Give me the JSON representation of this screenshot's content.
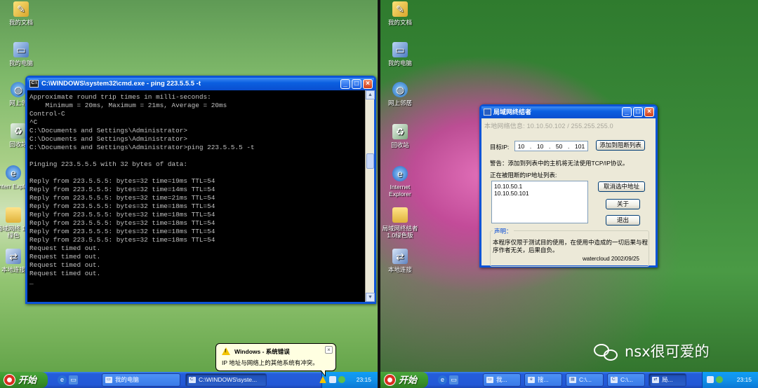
{
  "left_desktop": {
    "icons": [
      {
        "label": "我的文档",
        "icon": "my-documents-icon"
      },
      {
        "label": "我的电脑",
        "icon": "my-computer-icon"
      },
      {
        "label": "网上邻",
        "icon": "network-places-icon"
      },
      {
        "label": "回收站",
        "icon": "recycle-bin-icon"
      },
      {
        "label": "Interr Explor",
        "icon": "internet-explorer-icon"
      },
      {
        "label": "局域网终 1.0绿色",
        "icon": "folder-icon"
      },
      {
        "label": "本地连接",
        "icon": "network-connection-icon"
      }
    ]
  },
  "cmd": {
    "title": "C:\\WINDOWS\\system32\\cmd.exe - ping 223.5.5.5 -t",
    "output": "Approximate round trip times in milli-seconds:\n    Minimum = 20ms, Maximum = 21ms, Average = 20ms\nControl-C\n^C\nC:\\Documents and Settings\\Administrator>\nC:\\Documents and Settings\\Administrator>\nC:\\Documents and Settings\\Administrator>ping 223.5.5.5 -t\n\nPinging 223.5.5.5 with 32 bytes of data:\n\nReply from 223.5.5.5: bytes=32 time=19ms TTL=54\nReply from 223.5.5.5: bytes=32 time=14ms TTL=54\nReply from 223.5.5.5: bytes=32 time=21ms TTL=54\nReply from 223.5.5.5: bytes=32 time=18ms TTL=54\nReply from 223.5.5.5: bytes=32 time=18ms TTL=54\nReply from 223.5.5.5: bytes=32 time=18ms TTL=54\nReply from 223.5.5.5: bytes=32 time=18ms TTL=54\nReply from 223.5.5.5: bytes=32 time=18ms TTL=54\nRequest timed out.\nRequest timed out.\nRequest timed out.\nRequest timed out.\n_"
  },
  "balloon": {
    "title": "Windows - 系统错误",
    "message": "IP 地址与网络上的其他系统有冲突。",
    "close": "×"
  },
  "left_taskbar": {
    "start": "开始",
    "tasks": [
      {
        "label": "我的电脑",
        "active": false
      },
      {
        "label": "C:\\WINDOWS\\syste...",
        "active": true
      }
    ],
    "clock": "23:15"
  },
  "right_desktop": {
    "icons": [
      {
        "label": "我的文档",
        "icon": "my-documents-icon"
      },
      {
        "label": "我的电脑",
        "icon": "my-computer-icon"
      },
      {
        "label": "网上邻居",
        "icon": "network-places-icon"
      },
      {
        "label": "回收站",
        "icon": "recycle-bin-icon"
      },
      {
        "label": "Internet Explorer",
        "icon": "internet-explorer-icon"
      },
      {
        "label": "局域网终结者 1.0绿色版",
        "icon": "folder-icon"
      },
      {
        "label": "本地连接",
        "icon": "network-connection-icon"
      }
    ]
  },
  "lan": {
    "title": "局域网终结者",
    "info": "本地网络信息: 10.10.50.102 / 255.255.255.0",
    "target_label": "目标IP:",
    "ip_octets": [
      "10",
      "10",
      "50",
      "101"
    ],
    "add_button": "添加到阻断列表",
    "warning": "警告：添加到列表中的主机将无法使用TCP/IP协议。",
    "list_label": "正在被阻断的IP地址列表:",
    "blocked_ips": [
      "10.10.50.1",
      "10.10.50.101"
    ],
    "remove_button": "取消选中地址",
    "about_button": "关于",
    "exit_button": "退出",
    "statement_title": "声明：",
    "statement": "本程序仅限于测试目的使用，在使用中造成的一切后果与程序作者无关，后果自负。",
    "signature": "watercloud   2002/09/25"
  },
  "right_taskbar": {
    "start": "开始",
    "tasks": [
      {
        "label": "我...",
        "active": false
      },
      {
        "label": "搜...",
        "active": false
      },
      {
        "label": "C:\\...",
        "active": false
      },
      {
        "label": "C:\\...",
        "active": false
      },
      {
        "label": "局...",
        "active": true
      }
    ],
    "clock": "23:15"
  },
  "watermark": "nsx很可爱的",
  "colors": {
    "xp_blue": "#0b5fe0",
    "start_green": "#3c9a2c",
    "tray_blue": "#1290e8",
    "console_text": "#c0c0c0",
    "balloon_bg": "#ffffe1"
  }
}
